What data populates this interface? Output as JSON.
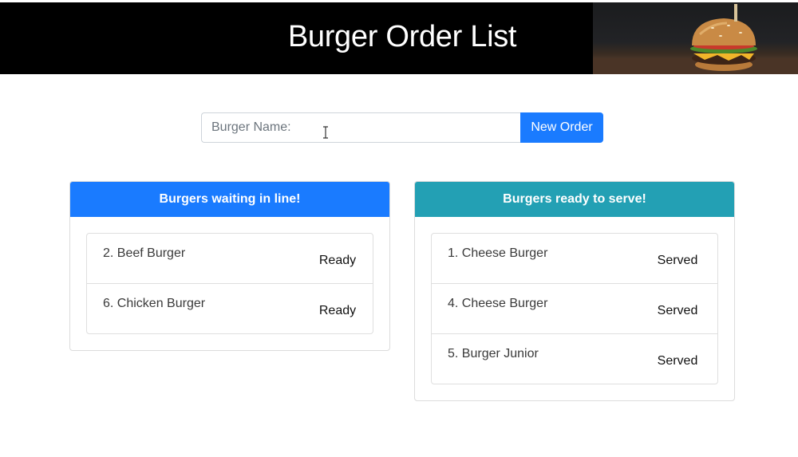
{
  "header": {
    "title": "Burger Order List",
    "photo": "burger-photo"
  },
  "form": {
    "placeholder": "Burger Name:",
    "value": "",
    "submit_label": "New Order"
  },
  "waiting": {
    "title": "Burgers waiting in line!",
    "items": [
      {
        "name": "2. Beef Burger",
        "action": "Ready"
      },
      {
        "name": "6. Chicken Burger",
        "action": "Ready"
      }
    ]
  },
  "served": {
    "title": "Burgers ready to serve!",
    "items": [
      {
        "name": "1. Cheese Burger",
        "action": "Served"
      },
      {
        "name": "4. Cheese Burger",
        "action": "Served"
      },
      {
        "name": "5. Burger Junior",
        "action": "Served"
      }
    ]
  },
  "colors": {
    "primary": "#1a7bff",
    "info": "#23a0b4",
    "header_bg": "#000000"
  }
}
